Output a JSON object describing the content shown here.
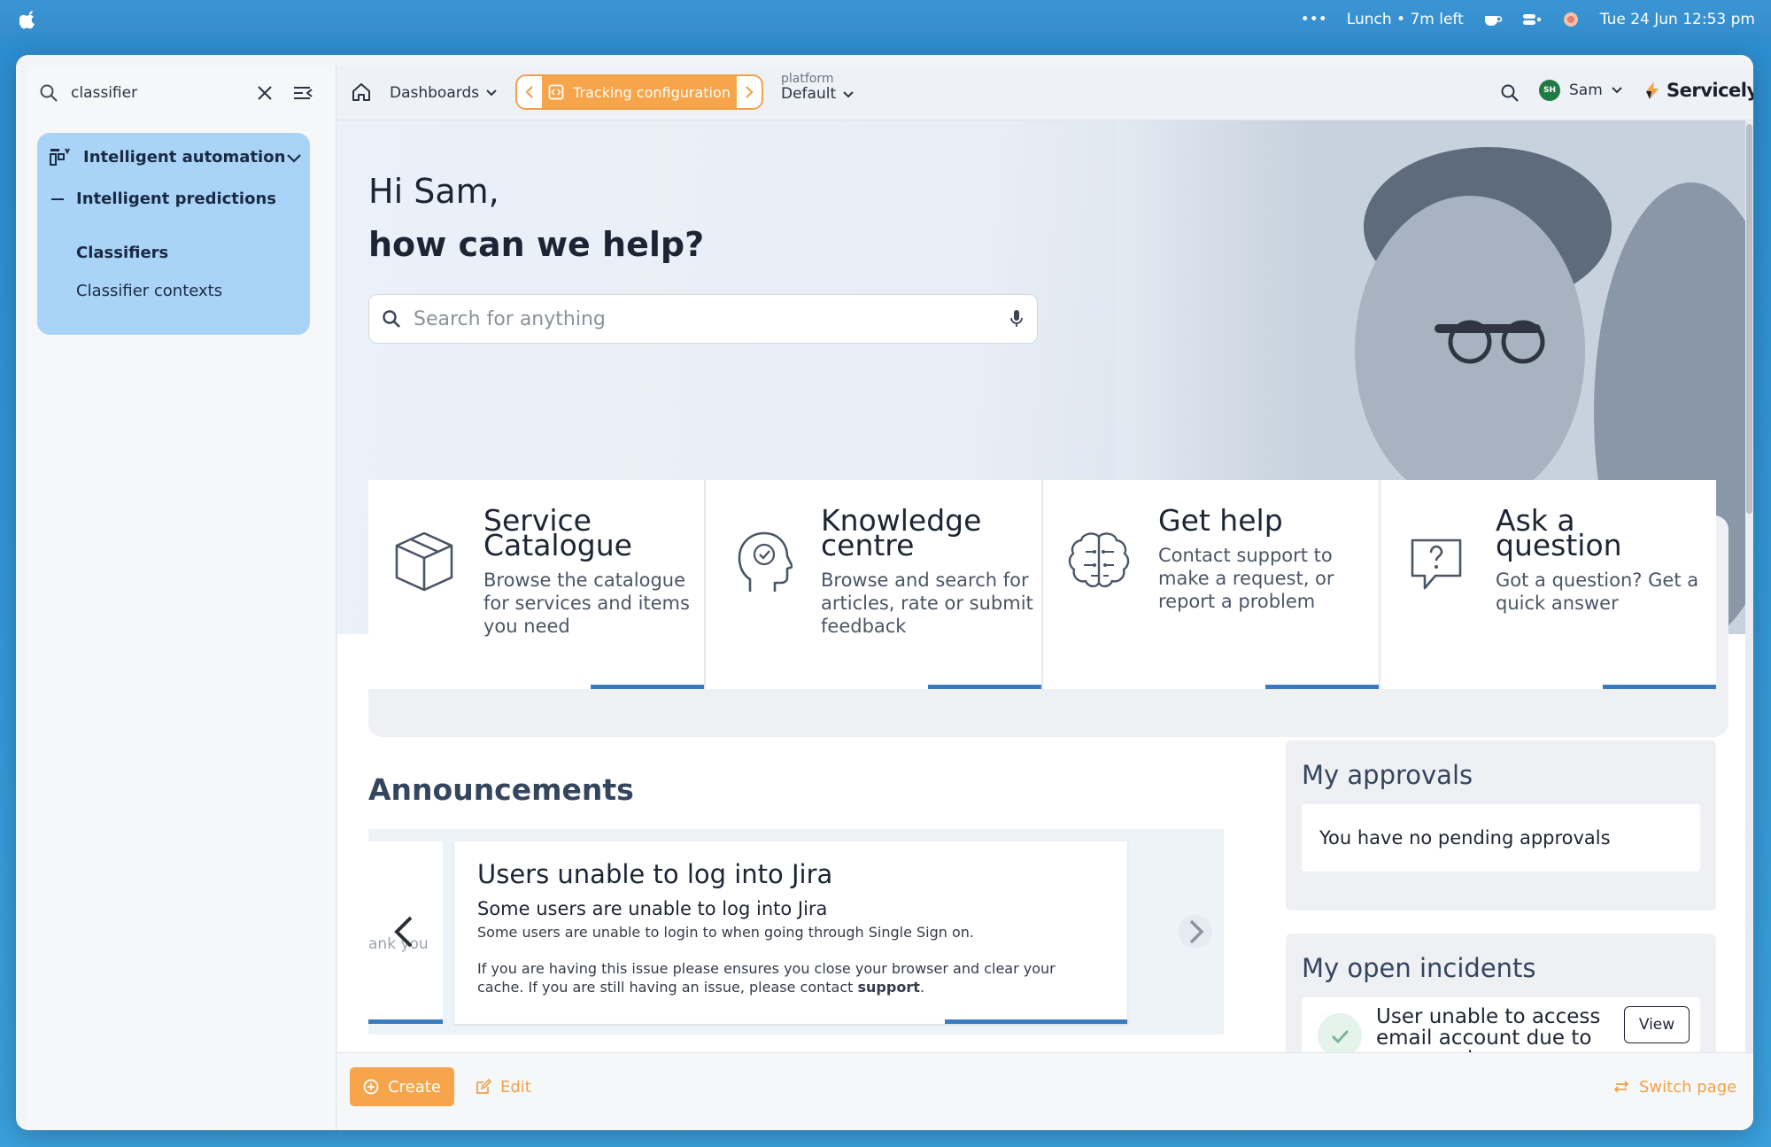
{
  "menubar": {
    "more": "•••",
    "lunch": "Lunch • 7m left",
    "datetime": "Tue 24 Jun  12:53 pm"
  },
  "topbar": {
    "sidebar_search_value": "classifier",
    "dashboards_label": "Dashboards",
    "tracking_label": "Tracking configuration",
    "platform_label": "platform",
    "platform_value": "Default",
    "user_initials": "SH",
    "user_name": "Sam",
    "brand": "Servicely"
  },
  "sidebar": {
    "section_label": "Intelligent automation",
    "subsection_label": "Intelligent predictions",
    "items": [
      {
        "label": "Classifiers",
        "active": true
      },
      {
        "label": "Classifier contexts",
        "active": false
      }
    ]
  },
  "hero": {
    "greeting_line1": "Hi Sam,",
    "greeting_line2": "how can we help?",
    "search_placeholder": "Search for anything"
  },
  "tiles": [
    {
      "title_line1": "Service",
      "title_line2": "Catalogue",
      "desc": "Browse the catalogue for services and items you need",
      "icon": "box-icon"
    },
    {
      "title_line1": "Knowledge",
      "title_line2": "centre",
      "desc": "Browse and search for articles, rate or submit feedback",
      "icon": "head-check-icon"
    },
    {
      "title_line1": "Get help",
      "title_line2": "",
      "desc": "Contact support to make a request, or report a problem",
      "icon": "brain-icon"
    },
    {
      "title_line1": "Ask a",
      "title_line2": "question",
      "desc": "Got a question? Get a quick answer",
      "icon": "question-bubble-icon"
    }
  ],
  "announcements": {
    "title": "Announcements",
    "ghost_text": "ank you",
    "card": {
      "heading": "Users unable to log into Jira",
      "subheading": "Some users are unable to log into Jira",
      "line1": "Some users are unable to login to when going through Single Sign on.",
      "line2_prefix": "If you are having this issue please ensures you close your browser and clear your cache.  If you are still having an issue, please contact ",
      "line2_link": "support",
      "line2_suffix": "."
    },
    "active_slide": 2,
    "slide_count": 2
  },
  "approvals": {
    "title": "My approvals",
    "empty_text": "You have no pending approvals"
  },
  "incidents": {
    "title": "My open incidents",
    "item_text": "User unable to access email account due to password",
    "view_label": "View"
  },
  "bottombar": {
    "create_label": "Create",
    "edit_label": "Edit",
    "switch_label": "Switch page"
  },
  "colors": {
    "accent_orange": "#f6a54a",
    "nav_blue": "#a9d4f7",
    "bar_blue": "#3b7bbf"
  }
}
